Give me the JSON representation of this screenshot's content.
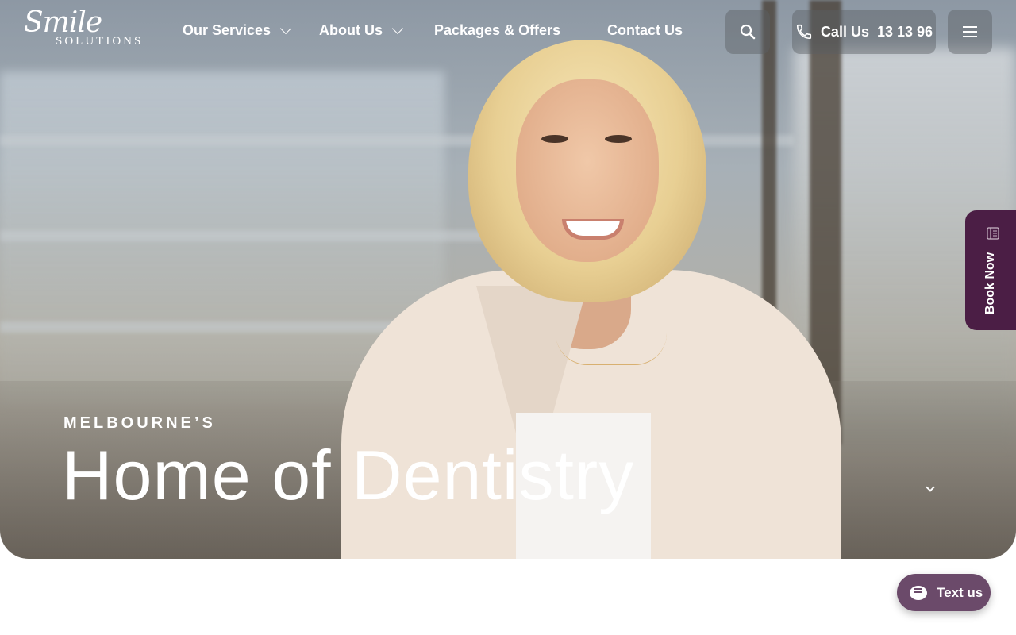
{
  "brand": {
    "logo_script": "Smile",
    "logo_sub": "SOLUTIONS"
  },
  "nav": {
    "items": [
      {
        "label": "Our Services",
        "has_dropdown": true
      },
      {
        "label": "About Us",
        "has_dropdown": true
      },
      {
        "label": "Packages & Offers",
        "has_dropdown": false
      },
      {
        "label": "Contact Us",
        "has_dropdown": false
      }
    ]
  },
  "header": {
    "search_icon": "search-icon",
    "call_label": "Call Us",
    "call_number": "13 13 96",
    "menu_icon": "hamburger-icon"
  },
  "hero": {
    "eyebrow": "MELBOURNE’S",
    "headline": "Home of Dentistry"
  },
  "side_tab": {
    "label": "Book Now",
    "icon": "calendar-book-icon"
  },
  "chat": {
    "label": "Text us",
    "icon": "chat-icon"
  },
  "colors": {
    "book_now_bg": "#4b1e45",
    "text_us_bg": "#6b4a6a",
    "page_bg": "#ffffff"
  }
}
